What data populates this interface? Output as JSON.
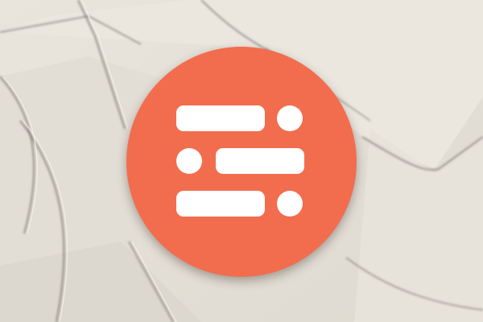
{
  "logo": {
    "icon": "segmented-list-icon",
    "circle_color": "#f26d4e",
    "mark_color": "#ffffff"
  },
  "background": {
    "description_icon": "envelopes-background",
    "base_color": "#e6e1d8",
    "shadow_color": "#5c5852"
  }
}
